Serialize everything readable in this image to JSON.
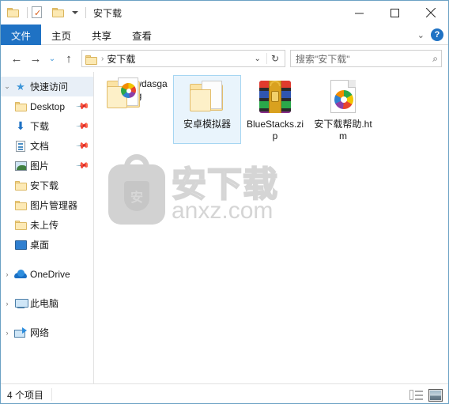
{
  "window": {
    "title": "安下载",
    "quick_access_toolbar": [
      {
        "icon": "folder-icon",
        "name": "properties-folder-icon"
      },
      {
        "icon": "properties-icon",
        "name": "properties-icon"
      },
      {
        "icon": "new-folder-icon",
        "name": "new-folder-icon"
      }
    ],
    "controls": {
      "minimize": "minimize-button",
      "maximize": "maximize-button",
      "close": "close-button"
    }
  },
  "ribbon": {
    "tabs": [
      {
        "label": "文件",
        "active": true
      },
      {
        "label": "主页",
        "active": false
      },
      {
        "label": "共享",
        "active": false
      },
      {
        "label": "查看",
        "active": false
      }
    ],
    "collapse_label": "⌄",
    "help_label": "?"
  },
  "navbar": {
    "back": "←",
    "forward": "→",
    "recent": "⌄",
    "up": "↑",
    "address": {
      "crumb": "安下载",
      "separator": "›",
      "dropdown": "⌄",
      "refresh": "↻"
    },
    "search": {
      "placeholder": "搜索\"安下载\"",
      "icon": "⌕"
    }
  },
  "sidebar": {
    "groups": [
      {
        "label": "快速访问",
        "icon": "star-pin-icon",
        "expanded": true,
        "selected": true,
        "chevron": "⌄",
        "items": [
          {
            "label": "Desktop",
            "icon": "folder-icon",
            "pinned": true
          },
          {
            "label": "下载",
            "icon": "download-icon",
            "pinned": true
          },
          {
            "label": "文档",
            "icon": "documents-icon",
            "pinned": true
          },
          {
            "label": "图片",
            "icon": "pictures-icon",
            "pinned": true
          },
          {
            "label": "安下载",
            "icon": "folder-icon",
            "pinned": false
          },
          {
            "label": "图片管理器",
            "icon": "folder-icon",
            "pinned": false
          },
          {
            "label": "未上传",
            "icon": "folder-icon",
            "pinned": false
          },
          {
            "label": "桌面",
            "icon": "desktop-icon",
            "pinned": false
          }
        ]
      },
      {
        "label": "OneDrive",
        "icon": "cloud-icon",
        "expanded": false,
        "chevron": "›",
        "items": []
      },
      {
        "label": "此电脑",
        "icon": "computer-icon",
        "expanded": false,
        "chevron": "›",
        "items": []
      },
      {
        "label": "网络",
        "icon": "network-icon",
        "expanded": false,
        "chevron": "›",
        "items": []
      }
    ],
    "pin_glyph": "📌"
  },
  "files": [
    {
      "name": "qnmqwdasgag",
      "type": "folder-with-preview",
      "selected": false
    },
    {
      "name": "安卓模拟器",
      "type": "folder",
      "selected": true
    },
    {
      "name": "BlueStacks.zip",
      "type": "archive",
      "selected": false
    },
    {
      "name": "安下载帮助.htm",
      "type": "html-document",
      "selected": false
    }
  ],
  "watermark": {
    "logo_char": "安",
    "brand": "安下载",
    "domain": "anxz.com"
  },
  "statusbar": {
    "count": "4 个项目",
    "views": [
      {
        "name": "details-view-button",
        "active": false
      },
      {
        "name": "large-icons-view-button",
        "active": true
      }
    ]
  },
  "colors": {
    "accent": "#1f72c4",
    "selection": "#e9f4fc",
    "selection_border": "#a6d6f2",
    "window_border": "#6ba1c4",
    "watermark_gray": "#d5d5d5"
  }
}
